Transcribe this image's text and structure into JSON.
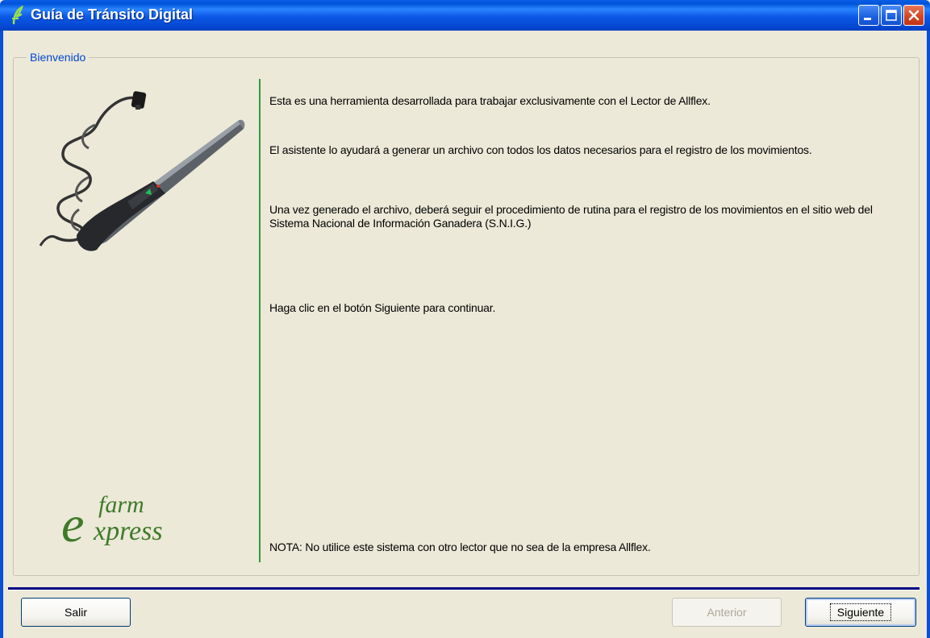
{
  "window": {
    "title": "Guía de Tránsito Digital",
    "controls": [
      "minimize",
      "maximize",
      "close"
    ]
  },
  "group": {
    "legend": "Bienvenido"
  },
  "content": {
    "intro": "Esta es una herramienta desarrollada para trabajar exclusivamente con el Lector de Allflex.",
    "wizard_info": "El asistente lo ayudará a generar un archivo con todos los datos necesarios para el registro de los movimientos.",
    "procedure": "Una vez generado el archivo, deberá seguir el procedimiento de rutina para el registro de los movimientos en el sitio web del Sistema Nacional de Información Ganadera (S.N.I.G.)",
    "instruction": "Haga clic en el botón Siguiente para continuar.",
    "note": "NOTA: No utilice este sistema con otro lector que no sea de la empresa Allflex."
  },
  "logo": {
    "text_e": "e",
    "text_farm": "farm",
    "text_xpress": "xpress"
  },
  "buttons": {
    "exit": "Salir",
    "previous": "Anterior",
    "next": "Siguiente"
  },
  "icons": {
    "app": "farm-leaf-icon",
    "minimize": "minimize-icon",
    "maximize": "maximize-icon",
    "close": "close-icon",
    "reader": "rfid-reader-wand-image"
  },
  "colors": {
    "titlebar": "#0053d8",
    "close_button": "#d2431f",
    "legend_text": "#0047d0",
    "divider_green": "#2c9a3a",
    "logo_green": "#3f7a2a",
    "separator": "#000080"
  }
}
